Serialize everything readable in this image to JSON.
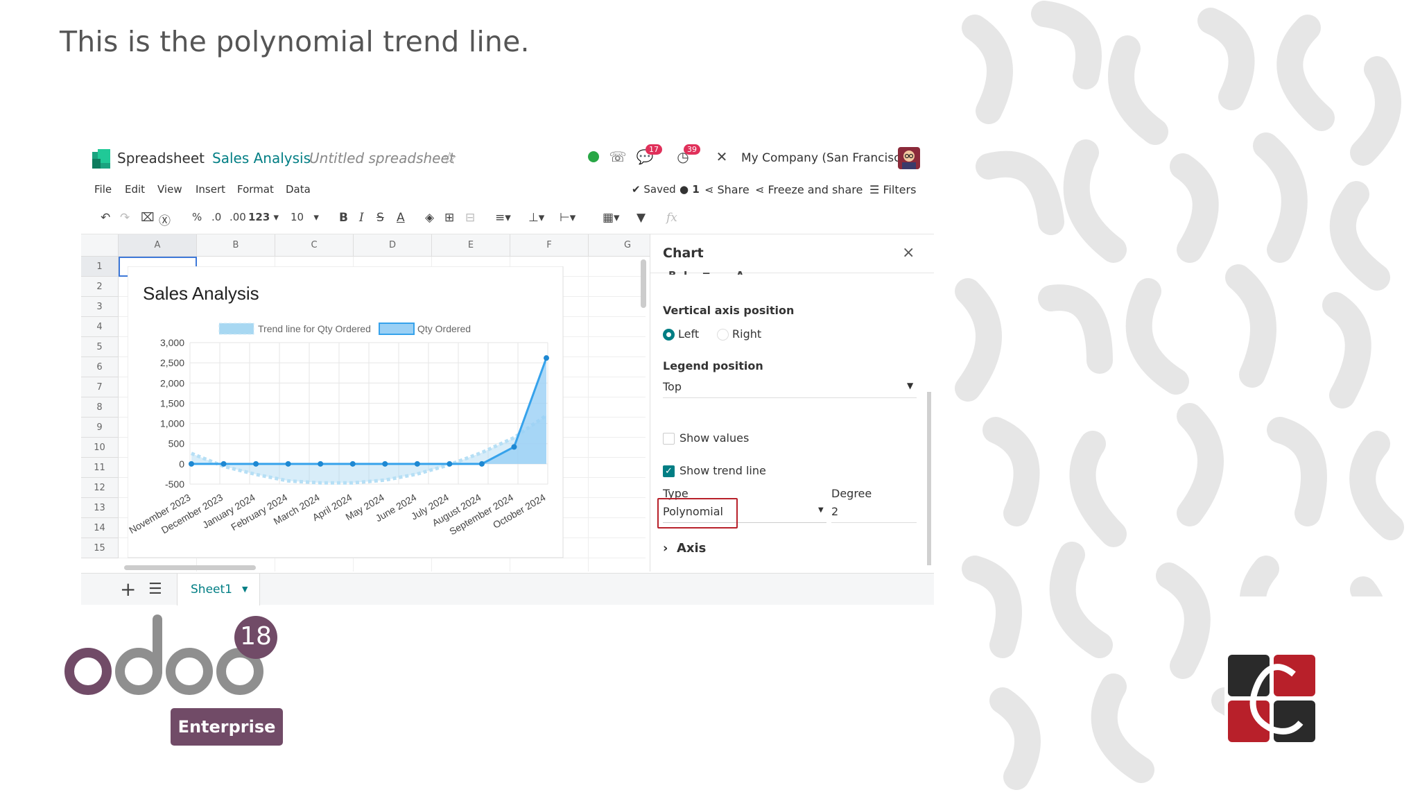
{
  "slide": {
    "title": "This is the polynomial trend line."
  },
  "topbar": {
    "app_name": "Spreadsheet",
    "doc_name": "Sales Analysis",
    "doc_subtitle": "Untitled spreadsheet",
    "chat_badge": "17",
    "activity_badge": "39",
    "company": "My Company (San Francisco)"
  },
  "menubar": {
    "items": [
      "File",
      "Edit",
      "View",
      "Insert",
      "Format",
      "Data"
    ],
    "saved": "Saved",
    "users": "1",
    "share": "Share",
    "freeze_share": "Freeze and share",
    "filters": "Filters"
  },
  "toolbar": {
    "percent": "%",
    "dec_minus": ".0",
    "dec_plus": ".00",
    "number_format": "123",
    "font_size": "10",
    "formula_placeholder": "fx"
  },
  "grid": {
    "columns": [
      "A",
      "B",
      "C",
      "D",
      "E",
      "F",
      "G"
    ],
    "rows": [
      "1",
      "2",
      "3",
      "4",
      "5",
      "6",
      "7",
      "8",
      "9",
      "10",
      "11",
      "12",
      "13",
      "14",
      "15"
    ]
  },
  "sheets": {
    "active": "Sheet1"
  },
  "panel": {
    "title": "Chart",
    "close": "×",
    "vertical_axis_label": "Vertical axis position",
    "axis_left": "Left",
    "axis_right": "Right",
    "legend_label": "Legend position",
    "legend_value": "Top",
    "show_values": "Show values",
    "show_trend": "Show trend line",
    "type_label": "Type",
    "type_value": "Polynomial",
    "degree_label": "Degree",
    "degree_value": "2",
    "axis_section": "Axis"
  },
  "branding": {
    "version": "18",
    "edition": "Enterprise"
  },
  "colors": {
    "accent": "#017e84",
    "odoo_purple": "#714b67",
    "highlight": "#c0202a",
    "series": "#36a2eb",
    "series_fill": "#9ad0f5",
    "trend": "#a8d8f2"
  },
  "chart_data": {
    "type": "line",
    "title": "Sales Analysis",
    "legend_position": "top",
    "categories": [
      "November 2023",
      "December 2023",
      "January 2024",
      "February 2024",
      "March 2024",
      "April 2024",
      "May 2024",
      "June 2024",
      "July 2024",
      "August 2024",
      "September 2024",
      "October 2024"
    ],
    "series": [
      {
        "name": "Qty Ordered",
        "values": [
          0,
          0,
          0,
          0,
          0,
          0,
          0,
          0,
          0,
          0,
          420,
          2620
        ],
        "filled": true
      },
      {
        "name": "Trend line for Qty Ordered",
        "values": [
          260,
          -60,
          -260,
          -420,
          -470,
          -470,
          -400,
          -250,
          -20,
          280,
          650,
          1200
        ],
        "dashed": true,
        "filled": true
      }
    ],
    "yticks": [
      "3,000",
      "2,500",
      "2,000",
      "1,500",
      "1,000",
      "500",
      "0",
      "-500"
    ],
    "ylim": [
      -500,
      3000
    ]
  }
}
